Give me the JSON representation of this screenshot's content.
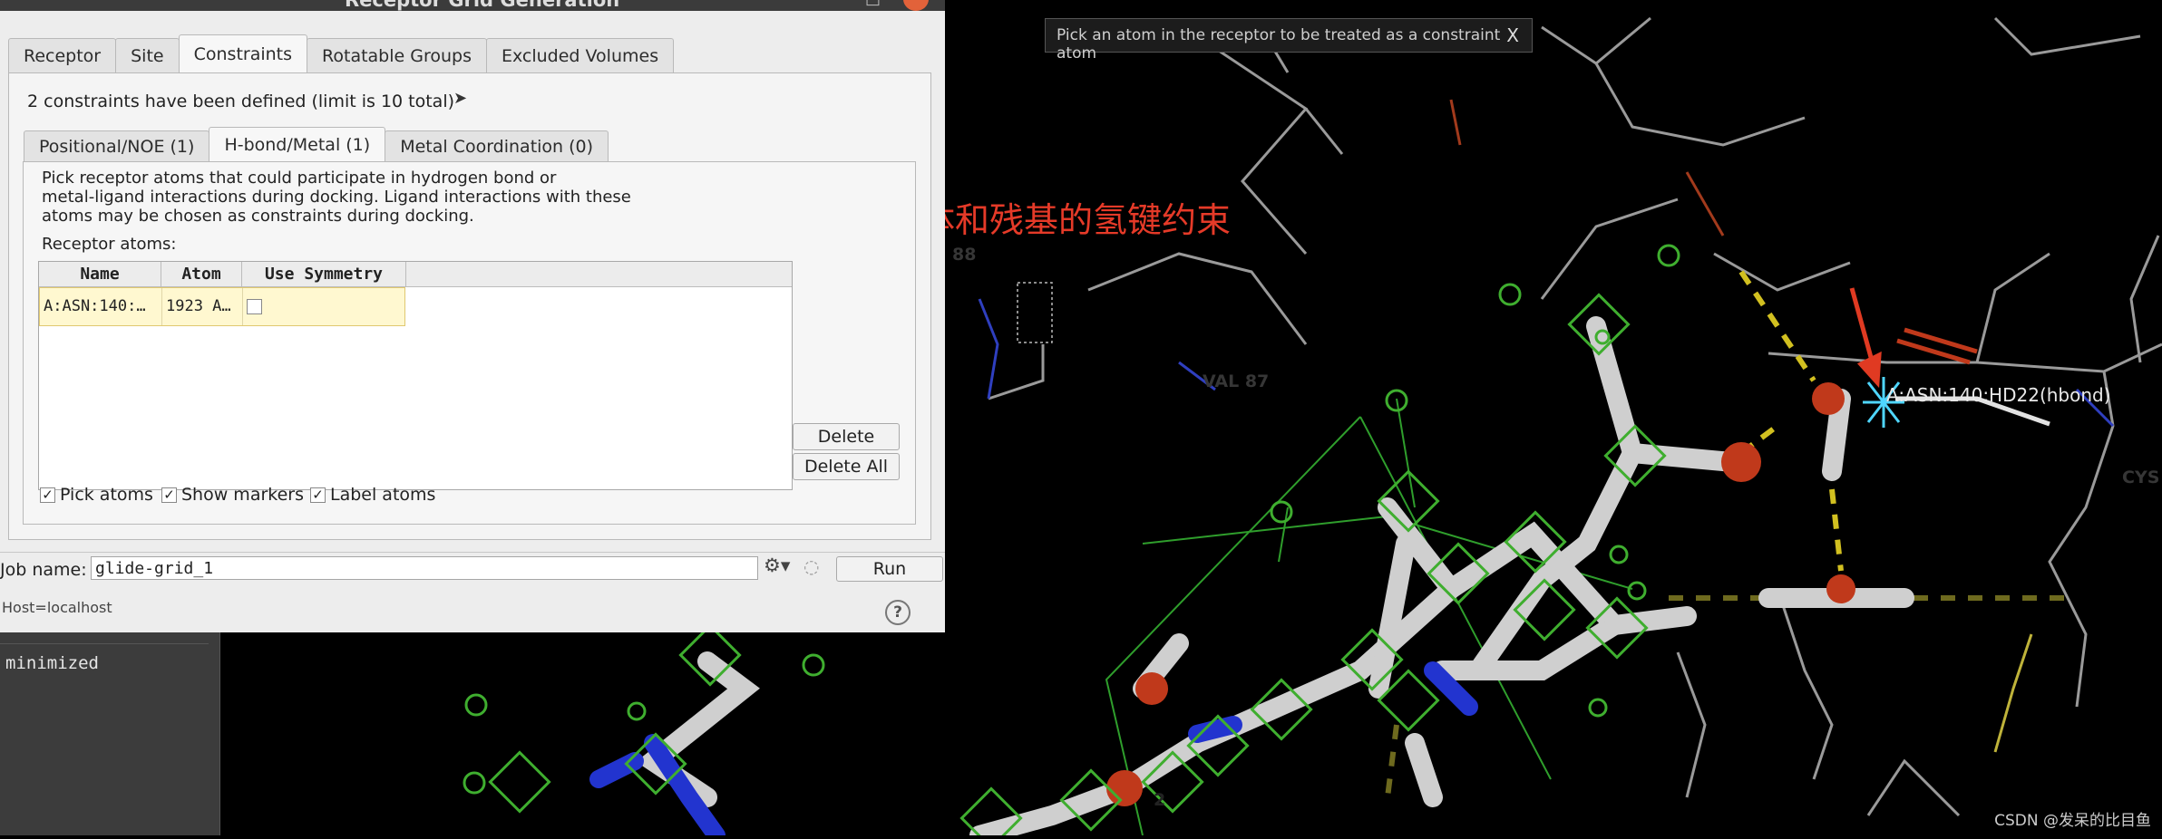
{
  "dialog": {
    "title": "Receptor Grid Generation",
    "tabs": [
      "Receptor",
      "Site",
      "Constraints",
      "Rotatable Groups",
      "Excluded Volumes"
    ],
    "active_tab": "Constraints",
    "constraints_summary": "2 constraints have been defined (limit is 10 total)",
    "subtabs": [
      "Positional/NOE (1)",
      "H-bond/Metal (1)",
      "Metal Coordination (0)"
    ],
    "active_subtab": "H-bond/Metal (1)",
    "description": [
      "Pick receptor atoms that could participate in hydrogen bond or",
      "metal-ligand interactions during docking.  Ligand interactions with these",
      "atoms may be chosen as constraints during docking."
    ],
    "receptor_atoms_label": "Receptor atoms:",
    "table": {
      "headers": [
        "Name",
        "Atom",
        "Use Symmetry"
      ],
      "rows": [
        {
          "name": "A:ASN:140:…",
          "atom": "1923 A…",
          "use_symmetry": false
        }
      ]
    },
    "delete_label": "Delete",
    "delete_all_label": "Delete All",
    "options": {
      "pick_atoms": {
        "label": "Pick atoms",
        "checked": true
      },
      "show_markers": {
        "label": "Show markers",
        "checked": true
      },
      "label_atoms": {
        "label": "Label atoms",
        "checked": true
      }
    },
    "job_name_label": "Job name:",
    "job_name_value": "glide-grid_1",
    "run_label": "Run",
    "host": "Host=localhost",
    "help_label": "?"
  },
  "left_panel": {
    "status": "minimized"
  },
  "viewer": {
    "pick_banner": "Pick an atom in the receptor to be treated as a constraint atom",
    "pick_banner_close": "X",
    "annotation": "配体和残基的氢键约束",
    "atom_label": "A:ASN:140:HD22(hbond)",
    "residue_labels": [
      "88",
      "VAL  87",
      "CYS"
    ],
    "markers": [
      "2"
    ],
    "annotation_color": "#e53a28",
    "marker_color": "#3fae2f"
  },
  "watermark": "CSDN @发呆的比目鱼"
}
